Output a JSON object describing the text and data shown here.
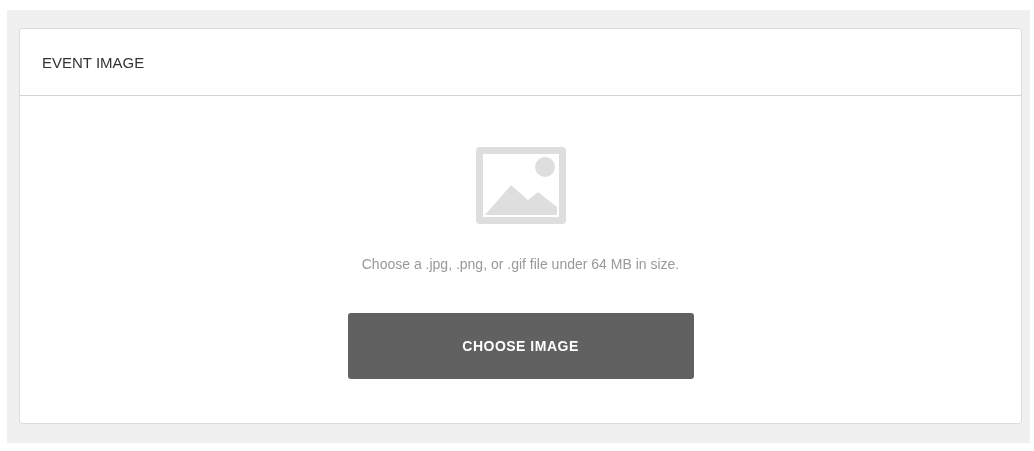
{
  "panel": {
    "title": "EVENT IMAGE"
  },
  "upload": {
    "hint": "Choose a .jpg, .png, or .gif file under 64 MB in size.",
    "button": "CHOOSE IMAGE"
  }
}
